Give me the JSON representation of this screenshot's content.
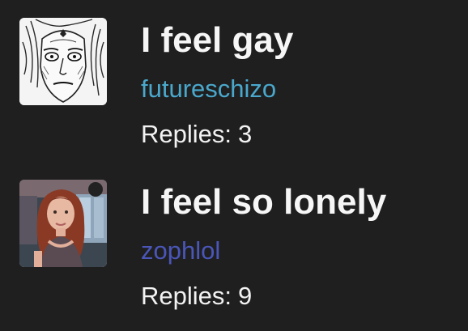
{
  "threads": [
    {
      "title": "I feel gay",
      "author": "futureschizo",
      "author_color": "#4aa8cc",
      "replies_label": "Replies:",
      "replies_count": "3",
      "avatar_icon": "manga-face-avatar"
    },
    {
      "title": "I feel so lonely",
      "author": "zophlol",
      "author_color": "#4a56b8",
      "replies_label": "Replies:",
      "replies_count": "9",
      "avatar_icon": "photo-girl-avatar"
    }
  ]
}
